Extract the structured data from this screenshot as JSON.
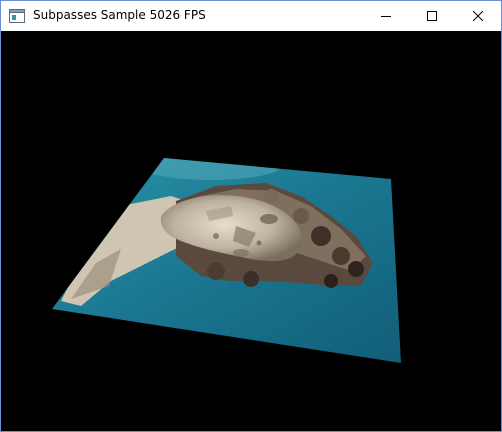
{
  "window": {
    "title": "Subpasses Sample 5026 FPS",
    "icon": "app-window-icon",
    "controls": [
      "minimize-icon",
      "maximize-icon",
      "close-icon"
    ]
  },
  "scene": {
    "background_color": "#000000",
    "content": "rotated textured quad showing statue head against teal sky",
    "sky_color": "#19748c",
    "stone_color": "#c9bfae"
  }
}
